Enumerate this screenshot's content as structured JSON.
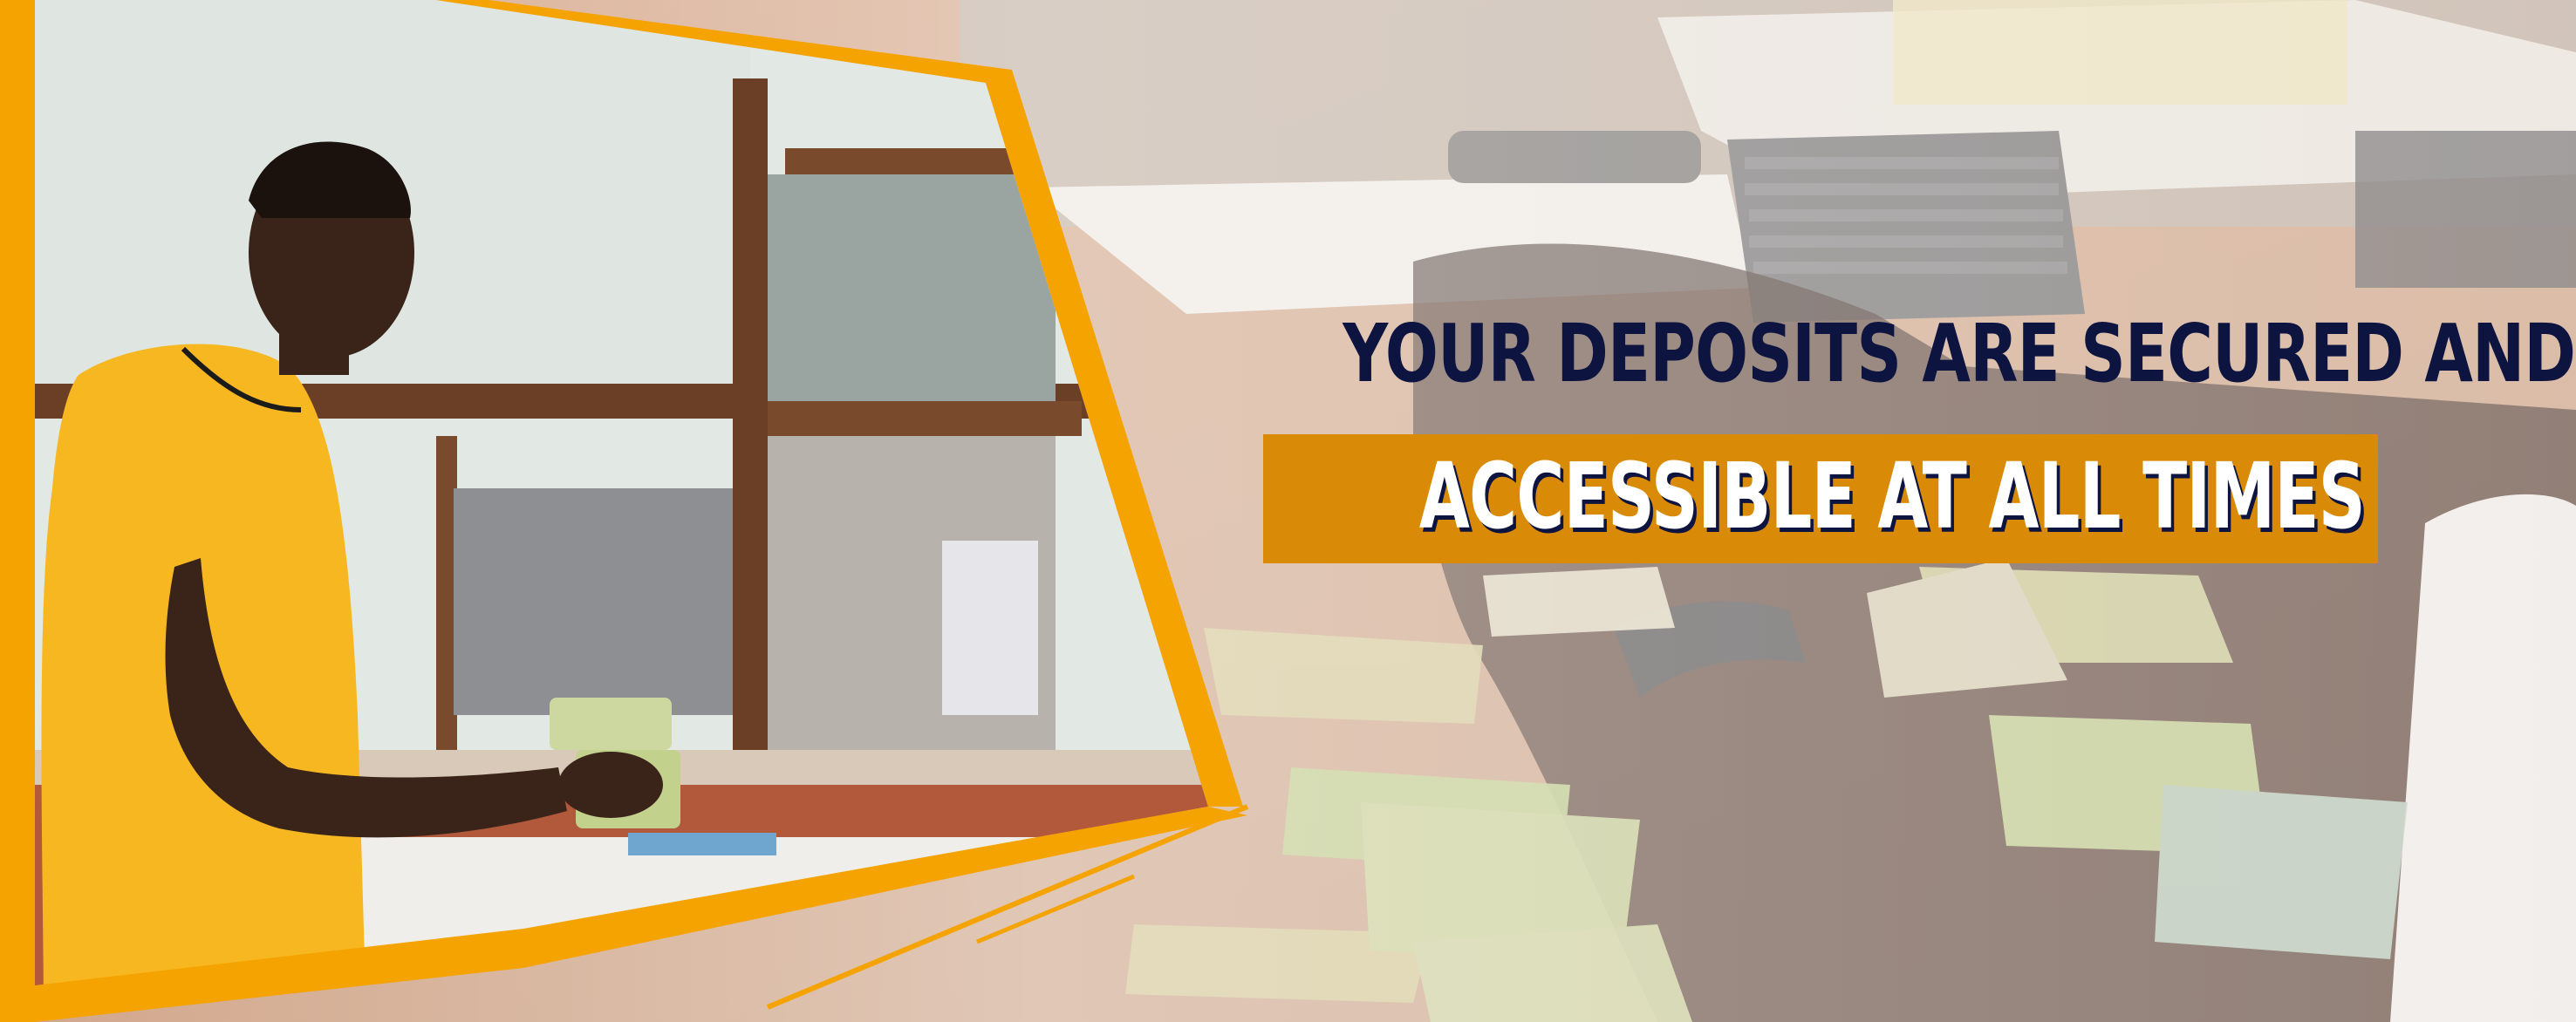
{
  "banner": {
    "headline_line1": "YOUR DEPOSITS ARE SECURED AND",
    "headline_line2": "ACCESSIBLE AT ALL TIMES"
  },
  "colors": {
    "accent_orange": "#f5a300",
    "highlight_box": "#d98a06",
    "navy_text": "#0d1440",
    "shirt_yellow": "#f6b720"
  },
  "images": {
    "left_photo": "customer-at-bank-counter",
    "background_photo": "hands-counting-cedi-banknotes"
  }
}
